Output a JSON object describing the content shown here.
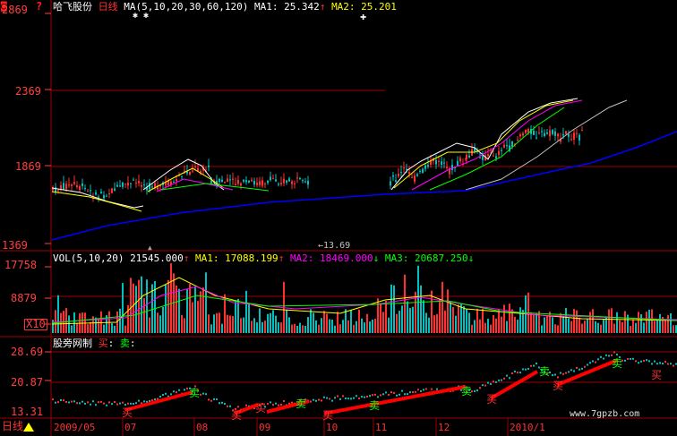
{
  "colors": {
    "grid": "#a00000",
    "axis": "#ff4040",
    "bg": "#000000",
    "ma5": "#ffffff",
    "ma10": "#ffff00",
    "ma20": "#ff00ff",
    "ma30": "#00ff00",
    "ma60": "#c0c0c0",
    "ma120": "#0000ff",
    "up": "#ff3030",
    "down": "#00c0c0",
    "signal": "#ff0000"
  },
  "toolbar": {
    "close_icon": "close-icon",
    "help_icon": "question-icon"
  },
  "price_panel": {
    "y_labels": [
      "2869",
      "2369",
      "1869",
      "1369"
    ],
    "stock_name": "哈飞股份",
    "period": "日线",
    "ma_label": "MA(5,10,20,30,60,120)",
    "ma1": "MA1: 25.342",
    "ma2": "MA2: 25.201",
    "low_marker": "13.69"
  },
  "volume_panel": {
    "y_labels": [
      "17758",
      "8879"
    ],
    "unit": "X10",
    "label": "VOL(5,10,20)",
    "vol": "21545.000",
    "ma1": "MA1: 17088.199",
    "ma2": "MA2: 18469.000",
    "ma3": "MA3: 20687.250"
  },
  "indicator_panel": {
    "y_labels": [
      "28.69",
      "20.87",
      "13.31"
    ],
    "title": "股旁网制",
    "buy": "买",
    "sell": "卖",
    "signals": [
      "买",
      "卖",
      "买",
      "买",
      "卖",
      "买",
      "卖",
      "卖",
      "买",
      "卖",
      "买",
      "卖",
      "买"
    ]
  },
  "bottom_bar": {
    "period": "日线",
    "dates": [
      "2009/05",
      "07",
      "08",
      "09",
      "10",
      "11",
      "12",
      "2010/1"
    ]
  },
  "watermark": "www.7gpzb.com"
}
